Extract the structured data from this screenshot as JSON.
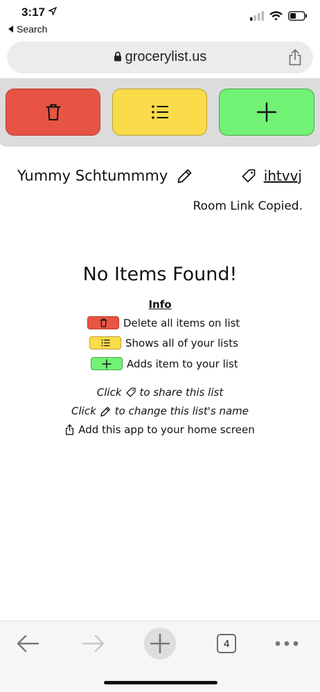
{
  "status": {
    "time": "3:17",
    "back_label": "Search"
  },
  "browser": {
    "url": "grocerylist.us",
    "tab_count": "4"
  },
  "list": {
    "name": "Yummy Schtummmy",
    "room_code": "ihtvvj",
    "room_status": "Room Link Copied."
  },
  "empty": {
    "title": "No Items Found!",
    "info_heading": "Info"
  },
  "legend": {
    "delete": "Delete all items on list",
    "lists": "Shows all of your lists",
    "add": "Adds item to your list"
  },
  "tips": {
    "share_prefix": "Click",
    "share_suffix": "to share this list",
    "rename_prefix": "Click",
    "rename_suffix": "to change this list's name",
    "home": "Add this app to your home screen"
  },
  "colors": {
    "delete": "#e85444",
    "lists": "#fadc4a",
    "add": "#72f275"
  },
  "icons": [
    "location-arrow-icon",
    "signal-icon",
    "wifi-icon",
    "battery-icon",
    "lock-icon",
    "share-icon",
    "trash-icon",
    "list-icon",
    "plus-icon",
    "pencil-icon",
    "tag-icon",
    "back-arrow-icon",
    "forward-arrow-icon",
    "more-icon"
  ]
}
